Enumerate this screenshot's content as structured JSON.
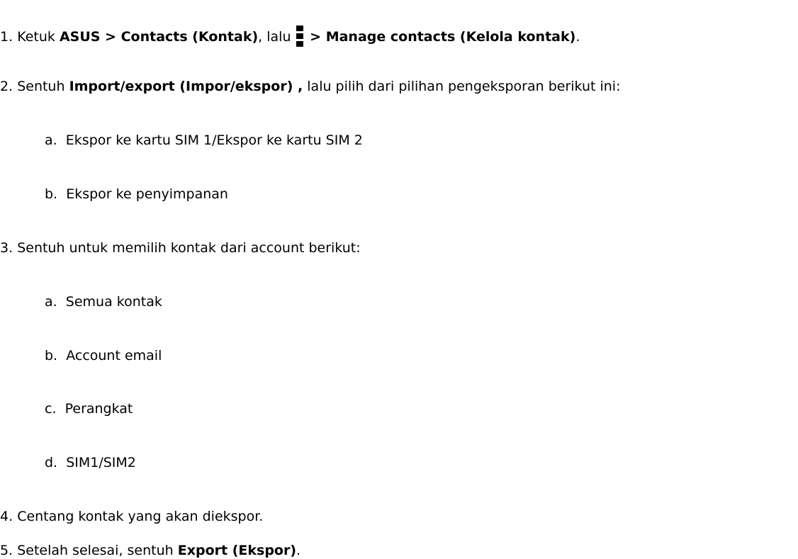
{
  "steps": {
    "s1": {
      "num": "1.",
      "t1": "Ketuk ",
      "b1": "ASUS > Contacts (Kontak)",
      "t2": ", lalu ",
      "icon": "more-vertical-icon",
      "t3": " > ",
      "b2": "Manage contacts (Kelola kontak)",
      "t4": "."
    },
    "s2": {
      "num": "2.",
      "t1": "Sentuh  ",
      "b1": "Import/export (Impor/ekspor) ,",
      "t2": " lalu pilih dari pilihan pengeksporan berikut ini:",
      "a": {
        "letter": "a.",
        "text": "Ekspor ke kartu SIM 1/Ekspor ke kartu SIM 2"
      },
      "b": {
        "letter": "b.",
        "text": "Ekspor ke penyimpanan"
      }
    },
    "s3": {
      "num": "3.",
      "text": " Sentuh untuk memilih kontak dari account berikut:",
      "a": {
        "letter": "a.",
        "text": "Semua kontak"
      },
      "b": {
        "letter": "b.",
        "text": "Account email"
      },
      "c": {
        "letter": "c.",
        "text": "Perangkat"
      },
      "d": {
        "letter": "d.",
        "text": "SIM1/SIM2"
      }
    },
    "s4": {
      "num": "4.",
      "text": "Centang kontak yang akan diekspor."
    },
    "s5": {
      "num": "5.",
      "t1": "Setelah selesai, sentuh ",
      "b1": "Export (Ekspor)",
      "t2": "."
    }
  }
}
